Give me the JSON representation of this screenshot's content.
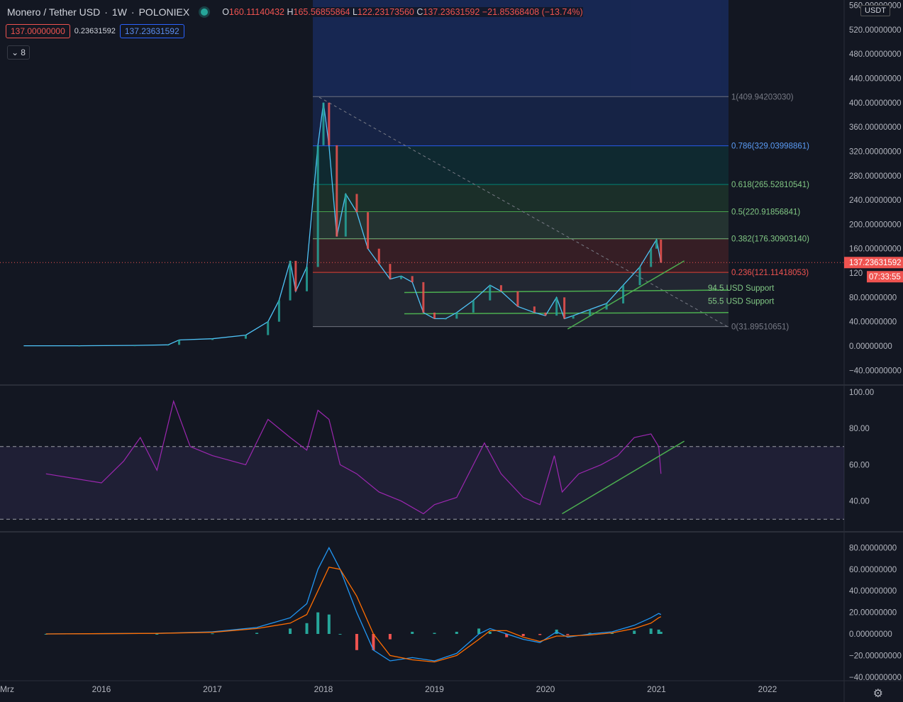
{
  "header": {
    "symbol": "Monero / Tether USD",
    "interval": "1W",
    "exchange": "POLONIEX",
    "ohlc": {
      "o_label": "O",
      "o": "160.11140432",
      "h_label": "H",
      "h": "165.56855864",
      "l_label": "L",
      "l": "122.23173560",
      "c_label": "C",
      "c": "137.23631592",
      "change": "−21.85368408 (−13.74%)"
    },
    "sell_price": "137.00000000",
    "spread": "0.23631592",
    "buy_price": "137.23631592",
    "indicators_count": "8",
    "currency_tag": "USDT"
  },
  "colors": {
    "background": "#131722",
    "up": "#26a69a",
    "down": "#ef5350",
    "rsi": "#9c27b0",
    "macd": "#2196f3",
    "signal": "#ff6d00",
    "trendline": "#4caf50"
  },
  "chart_data": [
    {
      "type": "line",
      "name": "price",
      "x_ticks": [
        "Mrz",
        "2016",
        "2017",
        "2018",
        "2019",
        "2020",
        "2021",
        "2022"
      ],
      "y_ticks": [
        "560.00000000",
        "520.00000000",
        "480.00000000",
        "440.00000000",
        "400.00000000",
        "360.00000000",
        "320.00000000",
        "280.00000000",
        "240.00000000",
        "200.00000000",
        "160.00000000",
        "120",
        "80.00000000",
        "40.00000000",
        "0.00000000",
        "−40.00000000"
      ],
      "ylim": [
        -40,
        560
      ],
      "last_price_label": "137.23631592",
      "countdown_label": "07:33:55",
      "series": [
        {
          "values": [
            [
              2015.3,
              0.5
            ],
            [
              2015.8,
              0.5
            ],
            [
              2016.3,
              1
            ],
            [
              2016.6,
              2
            ],
            [
              2016.7,
              10
            ],
            [
              2017.0,
              12
            ],
            [
              2017.3,
              18
            ],
            [
              2017.5,
              40
            ],
            [
              2017.6,
              75
            ],
            [
              2017.7,
              140
            ],
            [
              2017.75,
              90
            ],
            [
              2017.85,
              130
            ],
            [
              2017.95,
              330
            ],
            [
              2018.0,
              400
            ],
            [
              2018.05,
              330
            ],
            [
              2018.12,
              180
            ],
            [
              2018.2,
              250
            ],
            [
              2018.3,
              220
            ],
            [
              2018.4,
              160
            ],
            [
              2018.5,
              135
            ],
            [
              2018.6,
              110
            ],
            [
              2018.7,
              115
            ],
            [
              2018.8,
              105
            ],
            [
              2018.9,
              55
            ],
            [
              2019.0,
              45
            ],
            [
              2019.1,
              45
            ],
            [
              2019.2,
              55
            ],
            [
              2019.35,
              75
            ],
            [
              2019.5,
              100
            ],
            [
              2019.6,
              90
            ],
            [
              2019.75,
              65
            ],
            [
              2019.9,
              55
            ],
            [
              2020.0,
              50
            ],
            [
              2020.1,
              80
            ],
            [
              2020.17,
              45
            ],
            [
              2020.25,
              50
            ],
            [
              2020.4,
              60
            ],
            [
              2020.55,
              70
            ],
            [
              2020.7,
              100
            ],
            [
              2020.85,
              130
            ],
            [
              2020.95,
              160
            ],
            [
              2021.0,
              175
            ],
            [
              2021.04,
              137
            ]
          ]
        }
      ],
      "fib_levels": [
        {
          "label": "1(409.94203030)",
          "value": 409.94
        },
        {
          "label": "0.786(329.03998861)",
          "value": 329.04
        },
        {
          "label": "0.618(265.52810541)",
          "value": 265.53
        },
        {
          "label": "0.5(220.91856841)",
          "value": 220.92
        },
        {
          "label": "0.382(176.30903140)",
          "value": 176.31
        },
        {
          "label": "0.236(121.11418053)",
          "value": 121.11
        },
        {
          "label": "0(31.89510651)",
          "value": 31.9
        }
      ],
      "annotations": [
        "94.5 USD Support",
        "55.5 USD Support"
      ]
    },
    {
      "type": "line",
      "name": "RSI",
      "y_ticks": [
        "100.00",
        "80.00",
        "60.00",
        "40.00"
      ],
      "ylim": [
        25,
        100
      ],
      "bands": [
        70,
        30
      ],
      "series": [
        {
          "values": [
            [
              2015.5,
              55
            ],
            [
              2015.8,
              52
            ],
            [
              2016.0,
              50
            ],
            [
              2016.2,
              62
            ],
            [
              2016.35,
              75
            ],
            [
              2016.5,
              57
            ],
            [
              2016.65,
              95
            ],
            [
              2016.8,
              70
            ],
            [
              2017.0,
              65
            ],
            [
              2017.3,
              60
            ],
            [
              2017.5,
              85
            ],
            [
              2017.7,
              75
            ],
            [
              2017.85,
              68
            ],
            [
              2017.95,
              90
            ],
            [
              2018.05,
              85
            ],
            [
              2018.15,
              60
            ],
            [
              2018.3,
              55
            ],
            [
              2018.5,
              45
            ],
            [
              2018.7,
              40
            ],
            [
              2018.9,
              33
            ],
            [
              2019.0,
              38
            ],
            [
              2019.2,
              42
            ],
            [
              2019.35,
              60
            ],
            [
              2019.45,
              72
            ],
            [
              2019.6,
              55
            ],
            [
              2019.8,
              42
            ],
            [
              2019.95,
              38
            ],
            [
              2020.08,
              65
            ],
            [
              2020.15,
              45
            ],
            [
              2020.3,
              55
            ],
            [
              2020.5,
              60
            ],
            [
              2020.65,
              65
            ],
            [
              2020.8,
              75
            ],
            [
              2020.95,
              77
            ],
            [
              2021.02,
              70
            ],
            [
              2021.04,
              55
            ]
          ]
        }
      ]
    },
    {
      "type": "bar",
      "name": "MACD",
      "y_ticks": [
        "80.00000000",
        "60.00000000",
        "40.00000000",
        "20.00000000",
        "0.00000000",
        "−20.00000000",
        "−40.00000000"
      ],
      "ylim": [
        -40,
        80
      ],
      "series": [
        {
          "name": "macd",
          "values": [
            [
              2015.5,
              0
            ],
            [
              2016.5,
              0.5
            ],
            [
              2017.0,
              2
            ],
            [
              2017.4,
              6
            ],
            [
              2017.7,
              15
            ],
            [
              2017.85,
              28
            ],
            [
              2017.95,
              60
            ],
            [
              2018.05,
              80
            ],
            [
              2018.15,
              60
            ],
            [
              2018.3,
              20
            ],
            [
              2018.45,
              -15
            ],
            [
              2018.6,
              -25
            ],
            [
              2018.8,
              -22
            ],
            [
              2019.0,
              -25
            ],
            [
              2019.2,
              -18
            ],
            [
              2019.4,
              0
            ],
            [
              2019.5,
              5
            ],
            [
              2019.65,
              0
            ],
            [
              2019.8,
              -5
            ],
            [
              2019.95,
              -8
            ],
            [
              2020.1,
              2
            ],
            [
              2020.2,
              -3
            ],
            [
              2020.4,
              0
            ],
            [
              2020.6,
              2
            ],
            [
              2020.8,
              8
            ],
            [
              2020.95,
              15
            ],
            [
              2021.02,
              19
            ],
            [
              2021.04,
              18
            ]
          ]
        },
        {
          "name": "signal",
          "values": [
            [
              2015.5,
              0
            ],
            [
              2016.5,
              0.5
            ],
            [
              2017.0,
              1.5
            ],
            [
              2017.4,
              5
            ],
            [
              2017.7,
              10
            ],
            [
              2017.85,
              18
            ],
            [
              2017.95,
              40
            ],
            [
              2018.05,
              62
            ],
            [
              2018.15,
              60
            ],
            [
              2018.3,
              35
            ],
            [
              2018.45,
              0
            ],
            [
              2018.6,
              -20
            ],
            [
              2018.8,
              -24
            ],
            [
              2019.0,
              -26
            ],
            [
              2019.2,
              -20
            ],
            [
              2019.4,
              -5
            ],
            [
              2019.5,
              3
            ],
            [
              2019.65,
              3
            ],
            [
              2019.8,
              -3
            ],
            [
              2019.95,
              -7
            ],
            [
              2020.1,
              -2
            ],
            [
              2020.2,
              -2
            ],
            [
              2020.4,
              -1
            ],
            [
              2020.6,
              1
            ],
            [
              2020.8,
              5
            ],
            [
              2020.95,
              10
            ],
            [
              2021.02,
              15
            ],
            [
              2021.04,
              16
            ]
          ]
        }
      ]
    }
  ]
}
